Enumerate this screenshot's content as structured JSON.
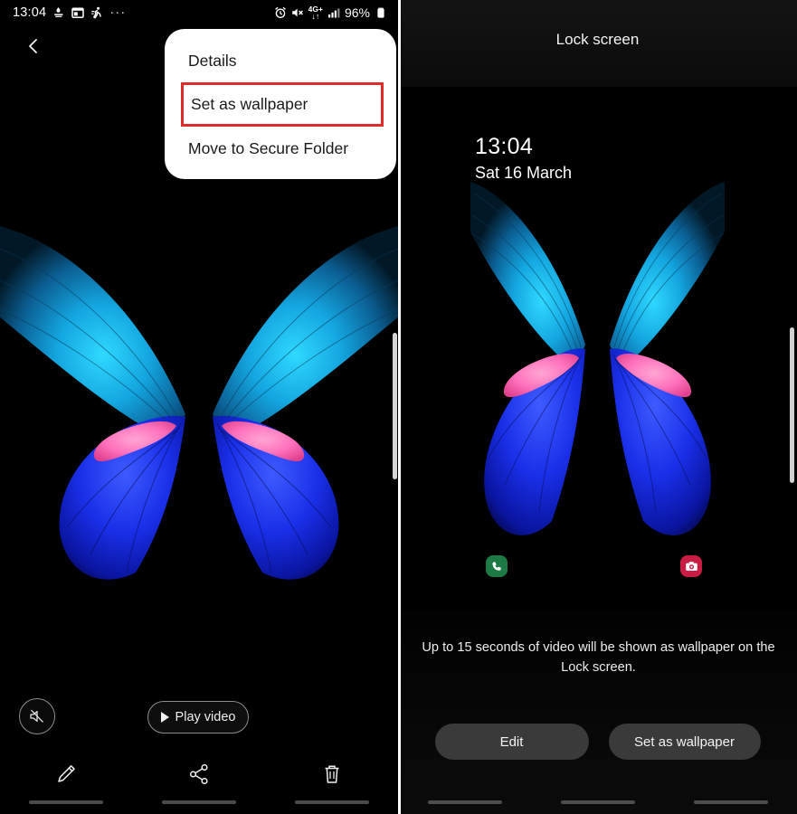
{
  "left_panel": {
    "status_bar": {
      "time": "13:04",
      "icons_left": [
        "do-not-disturb-icon",
        "calendar-icon",
        "running-icon",
        "overflow-dots-icon"
      ],
      "icons_right": [
        "alarm-icon",
        "mute-icon",
        "network-4g-plus-icon",
        "signal-bars-icon"
      ],
      "network_label": "4G+",
      "battery_percent": "96%"
    },
    "back_button_label": "back-arrow",
    "menu": {
      "items": [
        {
          "label": "Details",
          "highlighted": false
        },
        {
          "label": "Set as wallpaper",
          "highlighted": true
        },
        {
          "label": "Move to Secure Folder",
          "highlighted": false
        }
      ]
    },
    "controls": {
      "mute_icon": "mute-speaker-icon",
      "play_video_label": "Play video",
      "tools": [
        {
          "name": "edit-pencil-icon"
        },
        {
          "name": "share-icon"
        },
        {
          "name": "delete-trash-icon"
        }
      ]
    }
  },
  "right_panel": {
    "title": "Lock screen",
    "clock": {
      "time": "13:04",
      "date": "Sat 16 March"
    },
    "shortcuts": [
      {
        "name": "phone-shortcut",
        "color": "#1e7a44"
      },
      {
        "name": "camera-shortcut",
        "color": "#c81e45"
      }
    ],
    "caption": "Up to 15 seconds of video will be shown as wallpaper on the Lock screen.",
    "buttons": [
      {
        "label": "Edit"
      },
      {
        "label": "Set as wallpaper"
      }
    ]
  },
  "colors": {
    "highlight_box": "#e02b2b",
    "menu_background": "#ffffff",
    "menu_text": "#1a1a1a",
    "panel_background": "#000000",
    "button_background": "#3a3a3a",
    "wing_cyan": "#12b8e8",
    "wing_blue": "#1530e0",
    "wing_pink": "#ff7ec2"
  }
}
